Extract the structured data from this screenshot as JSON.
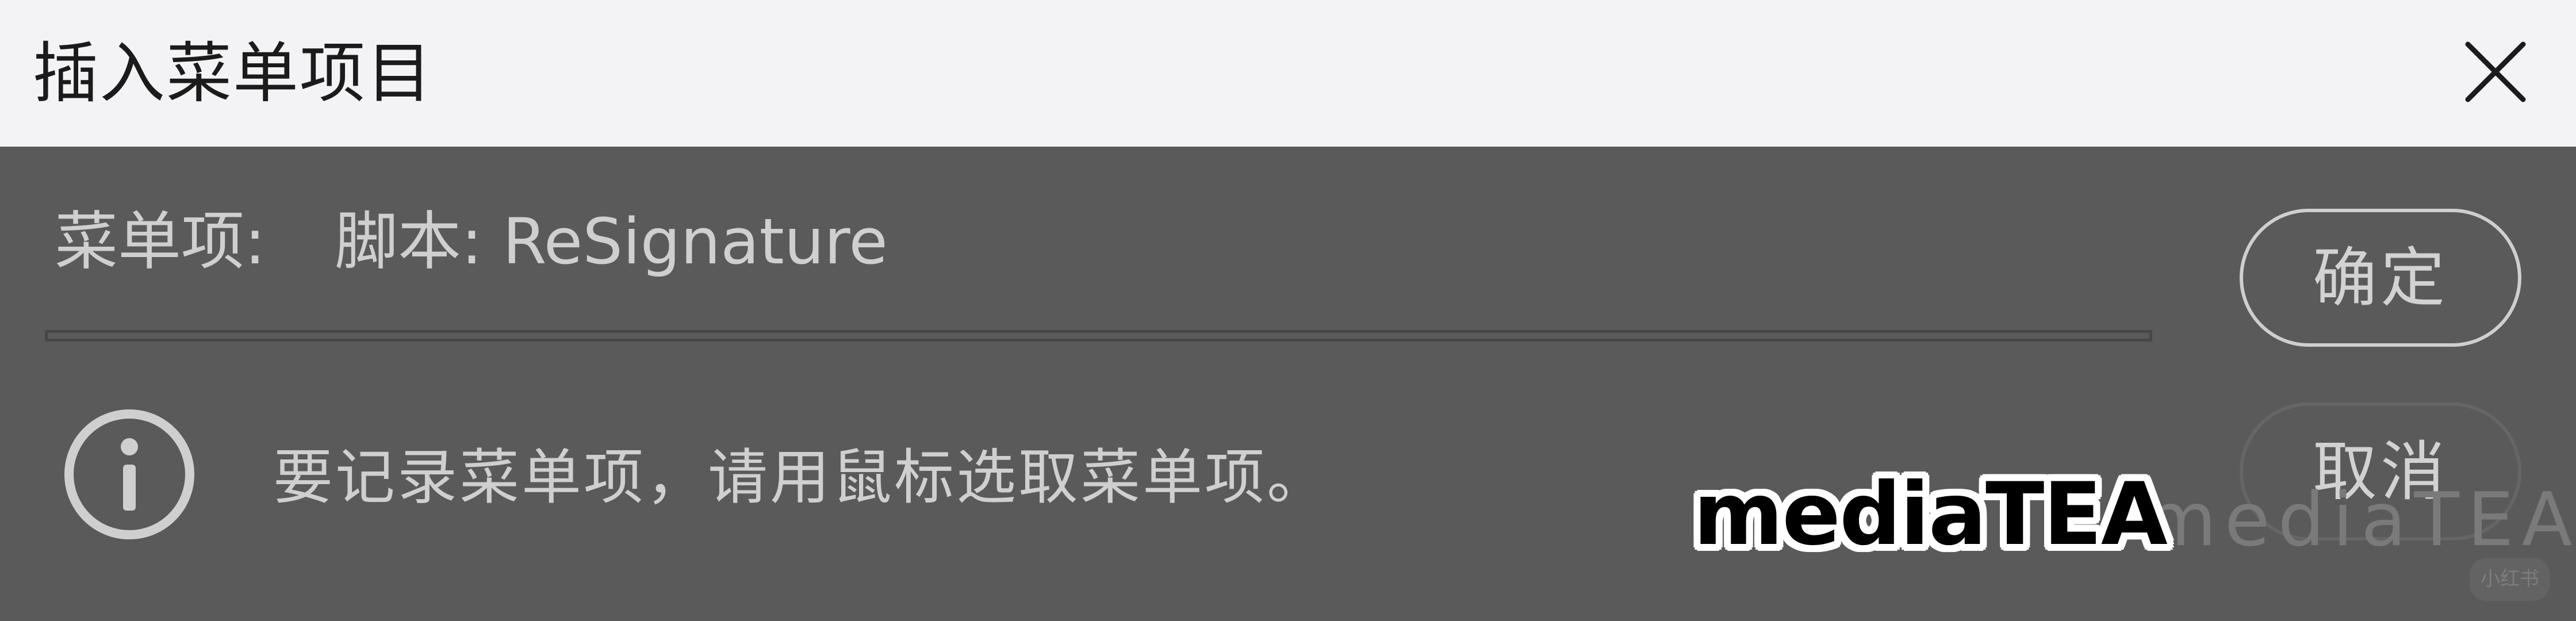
{
  "dialog": {
    "title": "插入菜单项目",
    "close_icon": "close-icon",
    "menu_item_label": "菜单项:",
    "menu_item_value": "脚本: ReSignature",
    "ok_label": "确定",
    "cancel_label": "取消",
    "info_icon": "info-icon",
    "hint": "要记录菜单项，请用鼠标选取菜单项。"
  },
  "watermarks": {
    "main": "mediaTEA",
    "ghost": "mediaTEA",
    "corner": "小红书"
  },
  "colors": {
    "titlebar_bg": "#f3f3f5",
    "body_bg": "#5a5a5a",
    "text_light": "#cfcfcf",
    "title_text": "#1b1b1b"
  }
}
